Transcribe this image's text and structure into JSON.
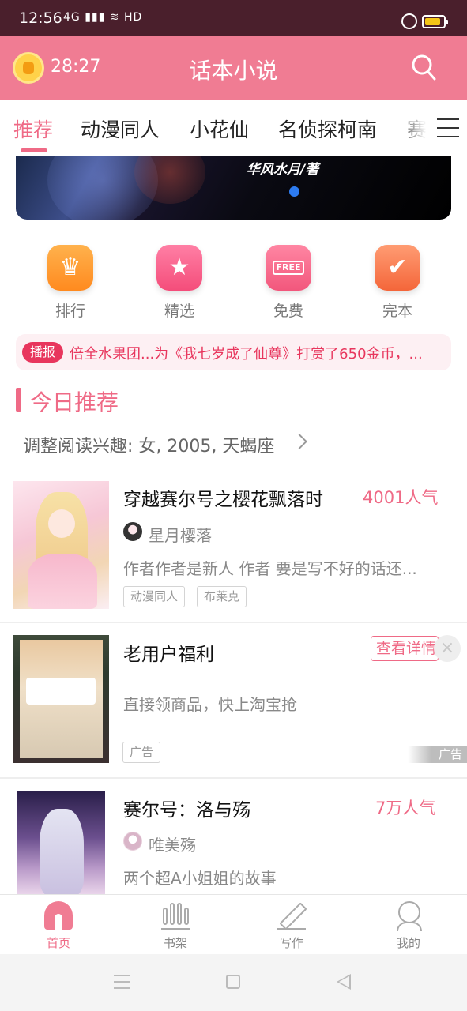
{
  "status_bar": {
    "time": "12:56",
    "network": "4G",
    "hd": "HD"
  },
  "header": {
    "timer": "28:27",
    "title": "话本小说"
  },
  "tabs": [
    {
      "label": "推荐",
      "active": true
    },
    {
      "label": "动漫同人"
    },
    {
      "label": "小花仙"
    },
    {
      "label": "名侦探柯南"
    },
    {
      "label": "赛尔"
    }
  ],
  "banner": {
    "author_text": "华风水月/著"
  },
  "quick_entries": [
    {
      "label": "排行",
      "icon": "trophy-icon"
    },
    {
      "label": "精选",
      "icon": "star-icon"
    },
    {
      "label": "免费",
      "icon": "free-icon",
      "badge": "FREE"
    },
    {
      "label": "完本",
      "icon": "check-book-icon"
    }
  ],
  "broadcast": {
    "badge": "播报",
    "text": "倍全水果团...为《我七岁成了仙尊》打赏了650金币，..."
  },
  "section": {
    "title": "今日推荐",
    "subtitle": "调整阅读兴趣: 女, 2005, 天蝎座"
  },
  "books": [
    {
      "title": "穿越赛尔号之樱花飘落时",
      "popularity": "4001人气",
      "author": "星月樱落",
      "desc": "作者作者是新人 作者 要是写不好的话还...",
      "tags": [
        "动漫同人",
        "布莱克"
      ]
    },
    {
      "title": "赛尔号：洛与殇",
      "popularity": "7万人气",
      "author": "唯美殇",
      "desc": "两个超A小姐姐的故事"
    }
  ],
  "ad": {
    "title": "老用户福利",
    "desc": "直接领商品，快上淘宝抢",
    "tag": "广告",
    "button": "查看详情",
    "close": "×",
    "mark": "广告"
  },
  "bottom_nav": [
    {
      "label": "首页",
      "active": true
    },
    {
      "label": "书架"
    },
    {
      "label": "写作"
    },
    {
      "label": "我的"
    }
  ],
  "colors": {
    "brand": "#f07c93",
    "accent": "#ef6a86",
    "status_bar": "#4a1f2c",
    "alert": "#e8365d"
  }
}
